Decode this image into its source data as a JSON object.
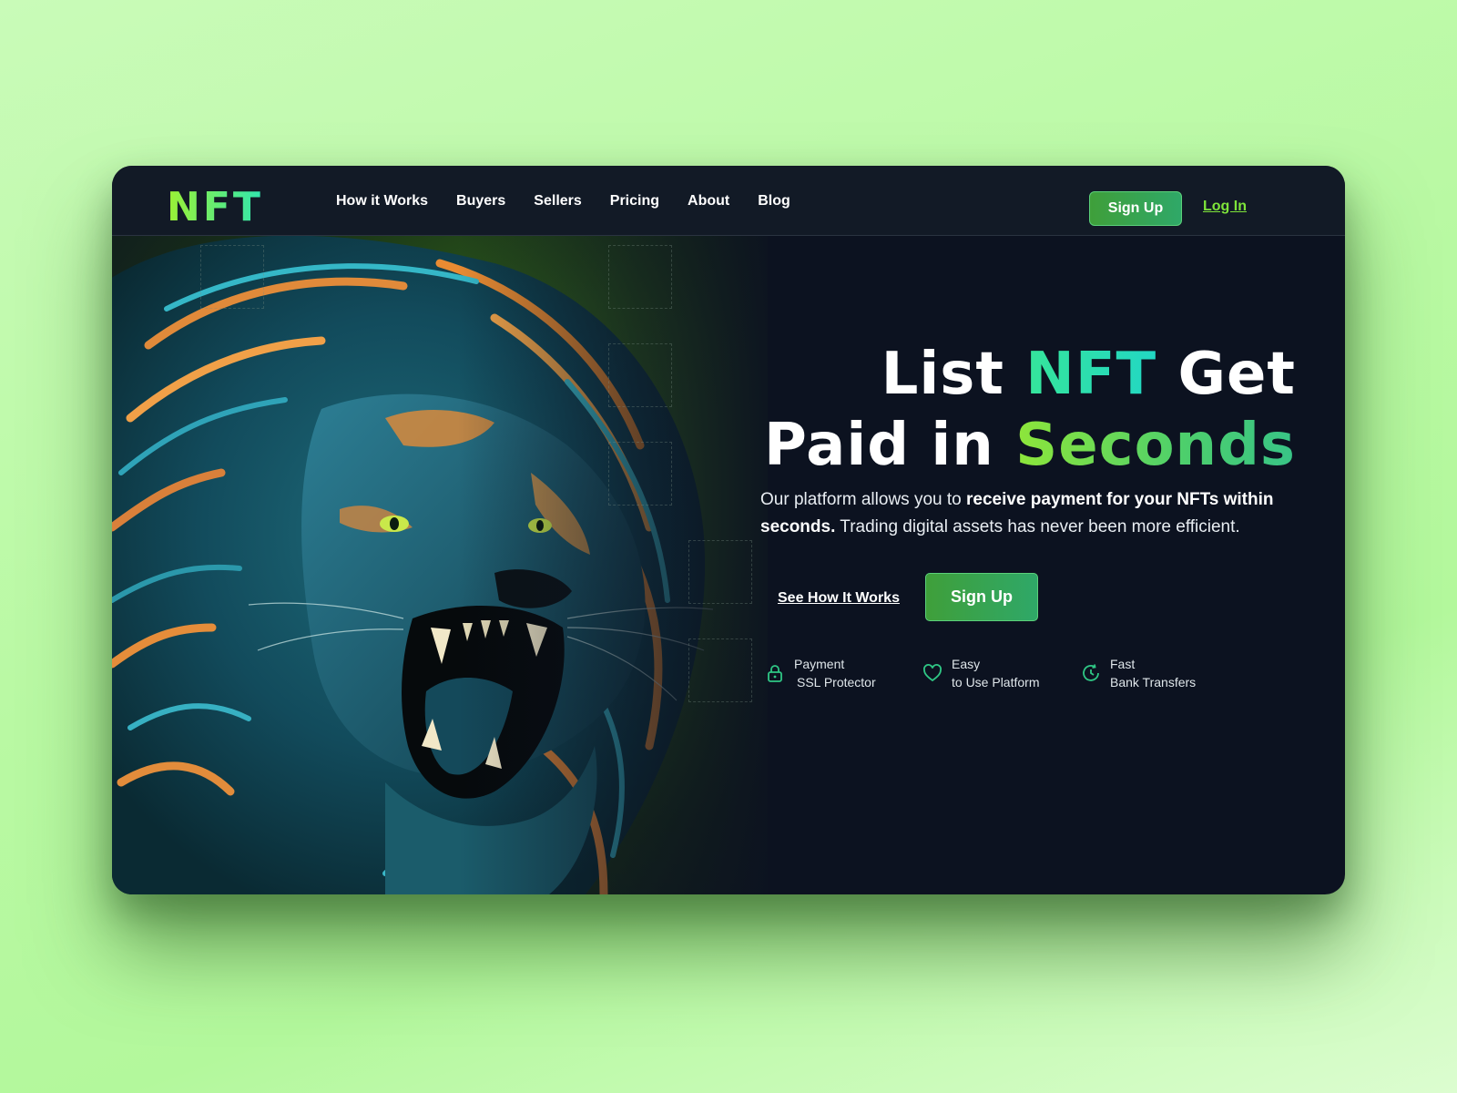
{
  "brand": {
    "logo": "NFT"
  },
  "nav": {
    "items": [
      "How it Works",
      "Buyers",
      "Sellers",
      "Pricing",
      "About",
      "Blog"
    ]
  },
  "header_actions": {
    "signup_label": "Sign Up",
    "login_label": "Log In"
  },
  "hero": {
    "headline_list": "List",
    "headline_nft": "NFT",
    "headline_get": "Get",
    "headline_paid": "Paid in",
    "headline_seconds": "Seconds",
    "desc_start": "Our platform allows you to ",
    "desc_bold": "receive payment for your NFTs within seconds.",
    "desc_end": " Trading digital assets has never been more efficient.",
    "see_how_label": "See How It Works",
    "signup_label": "Sign Up"
  },
  "features": [
    {
      "icon": "lock-icon",
      "line1": "Payment",
      "line2": "SSL Protector"
    },
    {
      "icon": "heart-icon",
      "line1": "Easy",
      "line2": "to Use Platform"
    },
    {
      "icon": "clock-icon",
      "line1": "Fast",
      "line2": "Bank Transfers"
    }
  ],
  "colors": {
    "accent_green": "#7ee43a",
    "button_green": "#3f9f3a",
    "card_bg": "#0c1220",
    "page_bg": "#b9f9a3"
  }
}
